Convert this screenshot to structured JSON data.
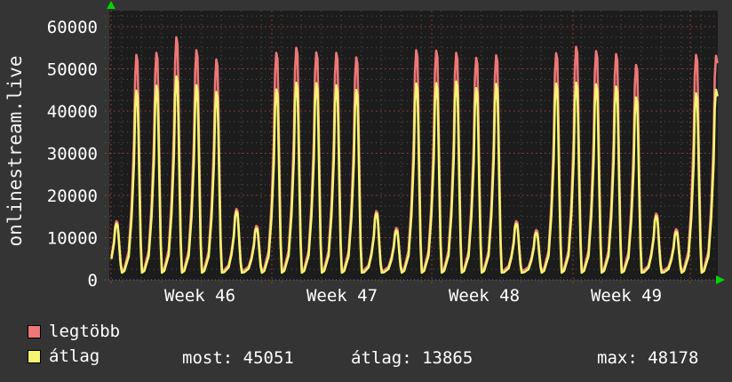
{
  "app": {
    "watermark": "onlinestream.live"
  },
  "colors": {
    "background": "#343434",
    "plot_background": "#1c1c1c",
    "text": "#ffffff",
    "axis_arrow": "#00d400",
    "grid_minor": "#9a9a9a",
    "grid_major": "#c24848"
  },
  "stats": [
    {
      "label": "most:",
      "value": "45051"
    },
    {
      "label": "átlag:",
      "value": "13865"
    },
    {
      "label": "max:",
      "value": "48178"
    }
  ],
  "chart_data": {
    "type": "line",
    "title": "",
    "xlabel": "",
    "ylabel": "",
    "x_tick_labels": [
      "Week 46",
      "Week 47",
      "Week 48",
      "Week 49"
    ],
    "y_ticks": [
      "0",
      "10000",
      "20000",
      "30000",
      "40000",
      "50000",
      "60000"
    ],
    "ylim": [
      0,
      63800
    ],
    "grid": {
      "minor_color": "#9a9a9a",
      "major_color": "#c24848",
      "minor_step_y": 2500,
      "major_step_y": 10000,
      "minor_step_x_days": 1,
      "major_step_x": "week"
    },
    "legend_position": "bottom-left",
    "series": [
      {
        "name": "legtöbb",
        "color": "#ee7777",
        "night_baseline": 2200,
        "daily_peaks": [
          13900,
          53300,
          53800,
          57500,
          54400,
          52200,
          16800,
          12800,
          53800,
          55000,
          53900,
          53800,
          52700,
          16300,
          12300,
          54400,
          54300,
          53800,
          52600,
          53200,
          13900,
          11800,
          53700,
          55200,
          54200,
          53500,
          50900,
          15700,
          12000,
          53300,
          53100
        ]
      },
      {
        "name": "átlag",
        "color": "#f5f571",
        "night_baseline": 1700,
        "daily_peaks": [
          13300,
          44800,
          46000,
          48178,
          46100,
          44500,
          16200,
          12200,
          45100,
          46700,
          46600,
          46100,
          45000,
          15700,
          11700,
          46500,
          46600,
          47000,
          45400,
          46400,
          13300,
          11200,
          46500,
          46700,
          46300,
          45800,
          43200,
          15100,
          11400,
          44200,
          45051
        ]
      }
    ]
  }
}
